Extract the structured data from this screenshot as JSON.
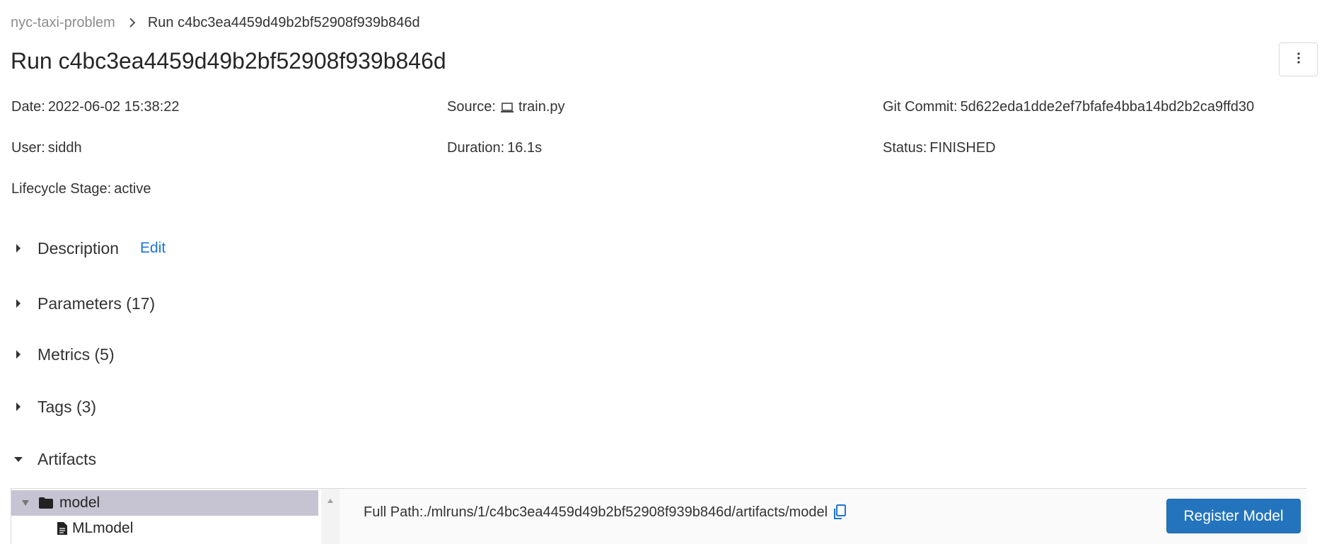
{
  "breadcrumb": {
    "experiment": "nyc-taxi-problem",
    "current": "Run c4bc3ea4459d49b2bf52908f939b846d"
  },
  "title": "Run c4bc3ea4459d49b2bf52908f939b846d",
  "meta": {
    "date_label": "Date:",
    "date_value": "2022-06-02 15:38:22",
    "source_label": "Source:",
    "source_value": "train.py",
    "git_label": "Git Commit:",
    "git_value": "5d622eda1dde2ef7bfafe4bba14bd2b2ca9ffd30",
    "user_label": "User:",
    "user_value": "siddh",
    "duration_label": "Duration:",
    "duration_value": "16.1s",
    "status_label": "Status:",
    "status_value": "FINISHED",
    "lifecycle_label": "Lifecycle Stage:",
    "lifecycle_value": "active"
  },
  "sections": {
    "description": "Description",
    "edit": "Edit",
    "parameters": "Parameters (17)",
    "metrics": "Metrics (5)",
    "tags": "Tags (3)",
    "artifacts": "Artifacts"
  },
  "artifacts": {
    "tree": [
      {
        "name": "model",
        "type": "folder",
        "expanded": true,
        "selected": true
      },
      {
        "name": "MLmodel",
        "type": "file"
      }
    ],
    "full_path_label": "Full Path:",
    "full_path_value": "./mlruns/1/c4bc3ea4459d49b2bf52908f939b846d/artifacts/model",
    "register_label": "Register Model"
  },
  "colors": {
    "accent": "#2374bd",
    "link": "#1d74d6",
    "selected_row": "#c6c3d3"
  },
  "icons": {
    "breadcrumb_separator": "chevron-right-icon",
    "more": "kebab-menu-icon",
    "source": "laptop-icon",
    "collapsed": "caret-right-icon",
    "expanded": "caret-down-icon",
    "folder": "folder-icon",
    "file": "file-icon",
    "copy": "copy-icon"
  }
}
